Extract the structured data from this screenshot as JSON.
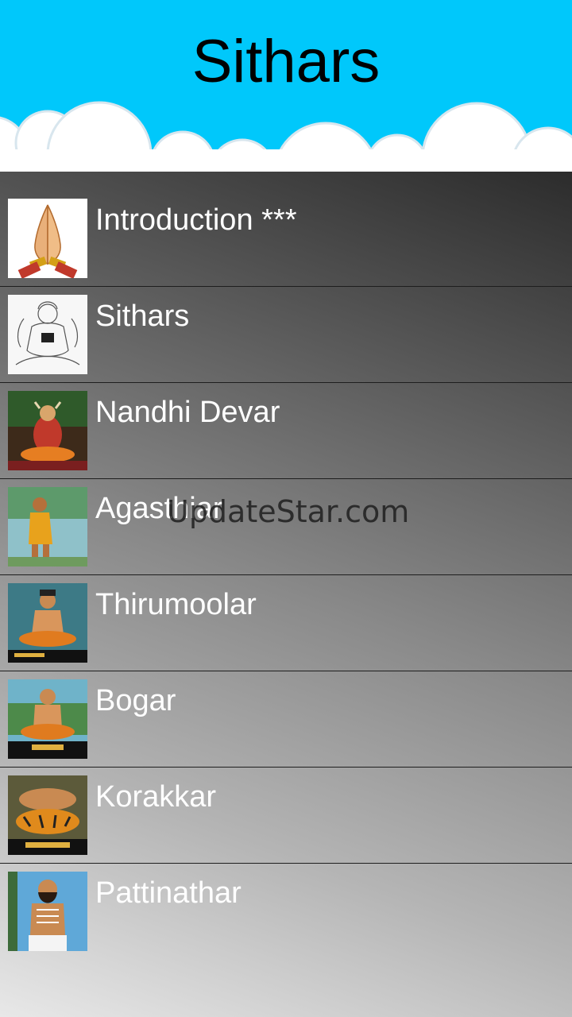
{
  "header": {
    "title": "Sithars",
    "background_color": "#00c8fb"
  },
  "list": {
    "items": [
      {
        "label": "Introduction ***",
        "thumbnail": "praying-hands-icon"
      },
      {
        "label": "Sithars",
        "thumbnail": "sithar-sketch-icon"
      },
      {
        "label": "Nandhi Devar",
        "thumbnail": "nandhi-devar-image"
      },
      {
        "label": "Agasthiar",
        "thumbnail": "agasthiar-image"
      },
      {
        "label": "Thirumoolar",
        "thumbnail": "thirumoolar-image"
      },
      {
        "label": "Bogar",
        "thumbnail": "bogar-image"
      },
      {
        "label": "Korakkar",
        "thumbnail": "korakkar-image"
      },
      {
        "label": "Pattinathar",
        "thumbnail": "pattinathar-image"
      }
    ]
  },
  "watermark": "UpdateStar.com"
}
